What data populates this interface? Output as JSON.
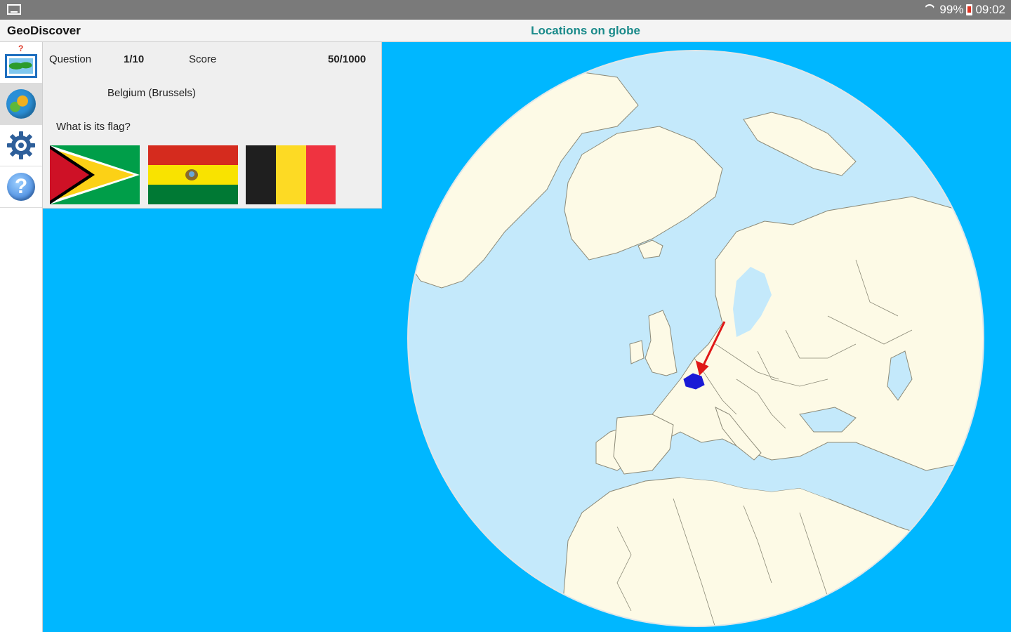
{
  "status_bar": {
    "battery": "99%",
    "time": "09:02"
  },
  "title_bar": {
    "app_title": "GeoDiscover",
    "page_title": "Locations on globe"
  },
  "sidebar": {
    "items": [
      {
        "name": "quiz-map",
        "icon": "map-quiz-icon"
      },
      {
        "name": "quiz-globe",
        "icon": "globe-icon",
        "active": true
      },
      {
        "name": "settings",
        "icon": "gear-icon"
      },
      {
        "name": "help",
        "icon": "help-icon"
      }
    ]
  },
  "quiz": {
    "question_label": "Question",
    "question_value": "1/10",
    "score_label": "Score",
    "score_value": "50/1000",
    "country": "Belgium (Brussels)",
    "prompt": "What is its flag?",
    "flags": [
      {
        "country": "Guyana"
      },
      {
        "country": "Bolivia"
      },
      {
        "country": "Belgium"
      }
    ]
  },
  "colors": {
    "ocean": "#00b7ff",
    "globe_sea": "#c4e9fb",
    "land": "#fdfae6",
    "highlight": "#1a1ad6",
    "arrow": "#e01818",
    "title_accent": "#1a8a8a"
  }
}
